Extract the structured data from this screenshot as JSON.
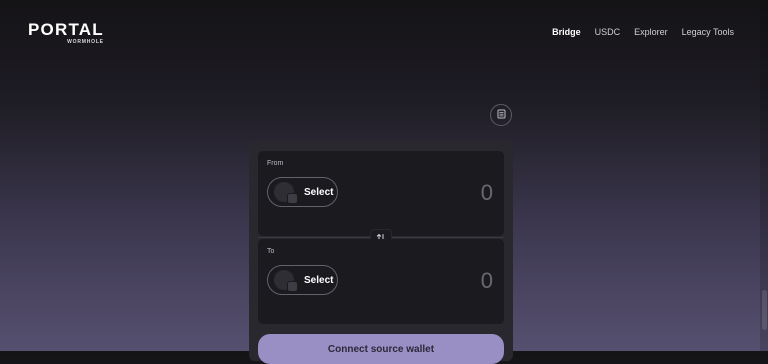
{
  "header": {
    "logo_main": "PORTAL",
    "logo_sub": "WORMHOLE",
    "nav": [
      {
        "label": "Bridge",
        "active": true
      },
      {
        "label": "USDC"
      },
      {
        "label": "Explorer"
      },
      {
        "label": "Legacy Tools"
      }
    ]
  },
  "config_button": {
    "icon": "config-icon"
  },
  "bridge": {
    "from": {
      "label": "From",
      "select_label": "Select",
      "amount_placeholder": "0"
    },
    "to": {
      "label": "To",
      "select_label": "Select",
      "amount_placeholder": "0"
    },
    "swap_icon": "swap-vertical-icon",
    "connect_button_label": "Connect source wallet"
  },
  "colors": {
    "accent": "#9a8fc4",
    "card": "#1b1a1f",
    "panel": "#2a282f"
  }
}
